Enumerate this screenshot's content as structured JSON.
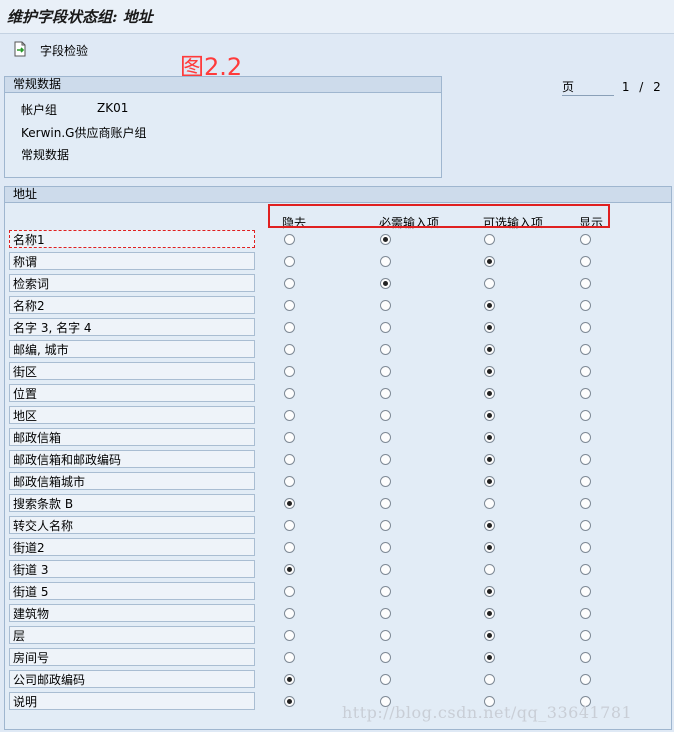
{
  "window": {
    "title": "维护字段状态组: 地址"
  },
  "toolbar": {
    "field_check_label": "字段检验",
    "icon": "field-check-icon"
  },
  "annotation": "图2.2",
  "pagination": {
    "label": "页",
    "current": "1",
    "separator": "/",
    "total": "2"
  },
  "general_data": {
    "title": "常规数据",
    "account_group_label": "帐户组",
    "account_group_value": "ZK01",
    "account_group_desc": "Kerwin.G供应商账户组",
    "section": "常规数据"
  },
  "address": {
    "title": "地址",
    "columns": [
      "隐去",
      "必需输入项",
      "可选输入项",
      "显示"
    ],
    "rows": [
      {
        "label": "名称1",
        "selected": 1
      },
      {
        "label": "称谓",
        "selected": 2
      },
      {
        "label": "检索词",
        "selected": 1
      },
      {
        "label": "名称2",
        "selected": 2
      },
      {
        "label": "名字 3, 名字 4",
        "selected": 2
      },
      {
        "label": "邮编, 城市",
        "selected": 2
      },
      {
        "label": "街区",
        "selected": 2
      },
      {
        "label": "位置",
        "selected": 2
      },
      {
        "label": "地区",
        "selected": 2
      },
      {
        "label": "邮政信箱",
        "selected": 2
      },
      {
        "label": "邮政信箱和邮政编码",
        "selected": 2
      },
      {
        "label": "邮政信箱城市",
        "selected": 2
      },
      {
        "label": "搜索条款 B",
        "selected": 0
      },
      {
        "label": "转交人名称",
        "selected": 2
      },
      {
        "label": "街道2",
        "selected": 2
      },
      {
        "label": "街道 3",
        "selected": 0
      },
      {
        "label": "街道 5",
        "selected": 2
      },
      {
        "label": "建筑物",
        "selected": 2
      },
      {
        "label": "层",
        "selected": 2
      },
      {
        "label": "房间号",
        "selected": 2
      },
      {
        "label": "公司邮政编码",
        "selected": 0
      },
      {
        "label": "说明",
        "selected": 0
      }
    ]
  },
  "watermark": "http://blog.csdn.net/qq_33641781"
}
